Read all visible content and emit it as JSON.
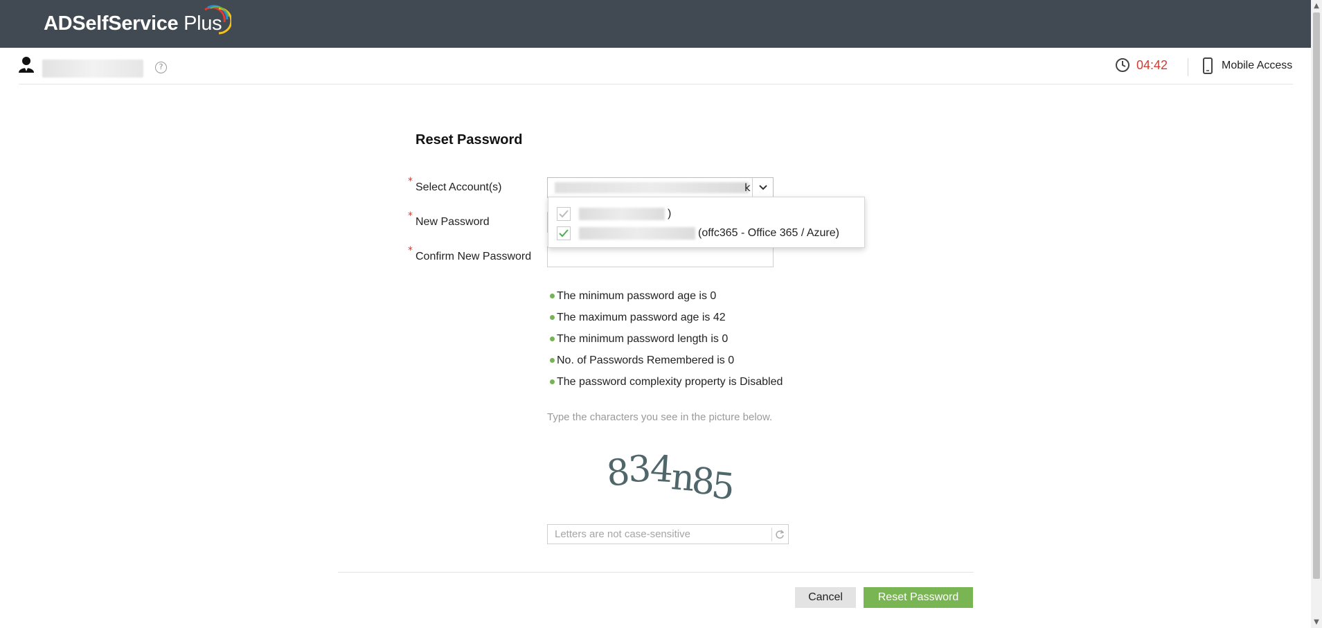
{
  "app": {
    "brand": "ADSelfService",
    "brand_suffix": " Plus"
  },
  "colors": {
    "header_bg": "#414a52",
    "accent_green": "#7ab553",
    "timer_red": "#d13b2f"
  },
  "subbar": {
    "timer": "04:42",
    "mobile_access": "Mobile Access",
    "help_symbol": "?"
  },
  "form": {
    "title": "Reset Password",
    "required_marker": "*",
    "select_label": "Select Account(s)",
    "select_value_tail": "k",
    "new_password_label": "New Password",
    "confirm_label": "Confirm New Password",
    "accounts": [
      {
        "label_suffix": ")",
        "checked": true,
        "disabled": true
      },
      {
        "label_suffix": "(offc365 - Office 365 / Azure)",
        "checked": true,
        "disabled": false
      }
    ],
    "rules": [
      "The minimum password age is 0",
      "The maximum password age is 42",
      "The minimum password length is 0",
      "No. of Passwords Remembered is 0",
      "The password complexity property is Disabled"
    ],
    "captcha_hint": "Type the characters you see in the picture below.",
    "captcha_text": "834n85",
    "captcha_placeholder": "Letters are not case-sensitive",
    "cancel_label": "Cancel",
    "reset_label": "Reset Password"
  }
}
